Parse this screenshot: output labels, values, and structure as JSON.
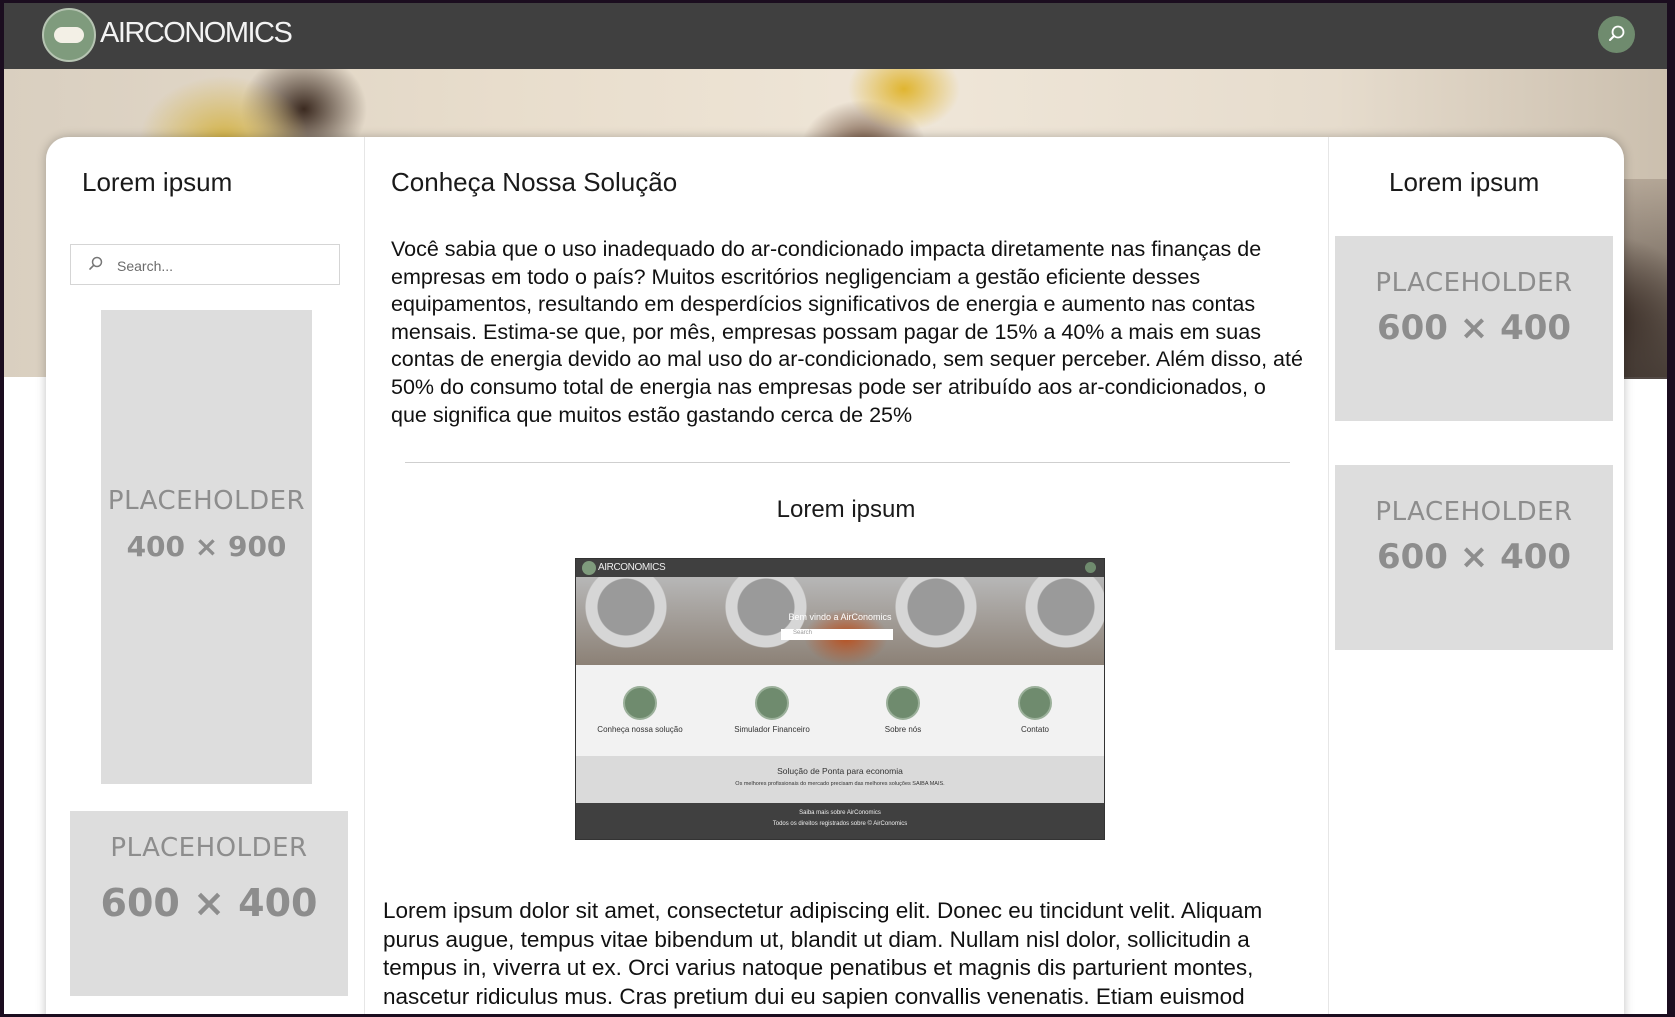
{
  "navbar": {
    "brand": "AIRCONOMICS",
    "search_icon": "search-icon",
    "background": "#404040",
    "accent": "#6f8b6e"
  },
  "sidebar_left": {
    "title": "Lorem ipsum",
    "search_placeholder": "Search...",
    "placeholders": [
      {
        "label": "PLACEHOLDER",
        "size": "400 × 900"
      },
      {
        "label": "PLACEHOLDER",
        "size": "600 × 400"
      }
    ]
  },
  "main": {
    "title": "Conheça Nossa Solução",
    "paragraph": "Você sabia que o uso inadequado do ar-condicionado impacta diretamente nas finanças de empresas em todo o país? Muitos escritórios negligenciam a gestão eficiente desses equipamentos, resultando em desperdícios significativos de energia e aumento nas contas mensais. Estima-se que, por mês, empresas possam pagar de 15% a 40% a mais em suas contas de energia devido ao mal uso do ar-condicionado, sem sequer perceber. Além disso, até 50% do consumo total de energia nas empresas pode ser atribuído aos ar-condicionados, o que significa que muitos estão gastando cerca de 25%",
    "subtitle": "Lorem ipsum",
    "screenshot": {
      "brand": "AIRCONOMICS",
      "welcome": "Bem vindo a AirConomics",
      "search_placeholder": "Search",
      "features": [
        {
          "label": "Conheça nossa solução",
          "icon": "rocket-icon"
        },
        {
          "label": "Simulador Financeiro",
          "icon": "calculator-icon"
        },
        {
          "label": "Sobre nós",
          "icon": "document-search-icon"
        },
        {
          "label": "Contato",
          "icon": "lightbulb-icon"
        }
      ],
      "band_title": "Solução de Ponta para economia",
      "band_text": "Os melhores profissionais do mercado precisam das melhores soluções SAIBA MAIS.",
      "footer_line1": "Saiba mais sobre AirConomics",
      "footer_line2": "Todos os direitos registrados sobre © AirConomics"
    },
    "paragraph2": "Lorem ipsum dolor sit amet, consectetur adipiscing elit. Donec eu tincidunt velit. Aliquam purus augue, tempus vitae bibendum ut, blandit ut diam. Nullam nisl dolor, sollicitudin a tempus in, viverra ut ex. Orci varius natoque penatibus et magnis dis parturient montes, nascetur ridiculus mus. Cras pretium dui eu sapien convallis venenatis. Etiam euismod"
  },
  "sidebar_right": {
    "title": "Lorem ipsum",
    "placeholders": [
      {
        "label": "PLACEHOLDER",
        "size": "600 × 400"
      },
      {
        "label": "PLACEHOLDER",
        "size": "600 × 400"
      }
    ]
  }
}
